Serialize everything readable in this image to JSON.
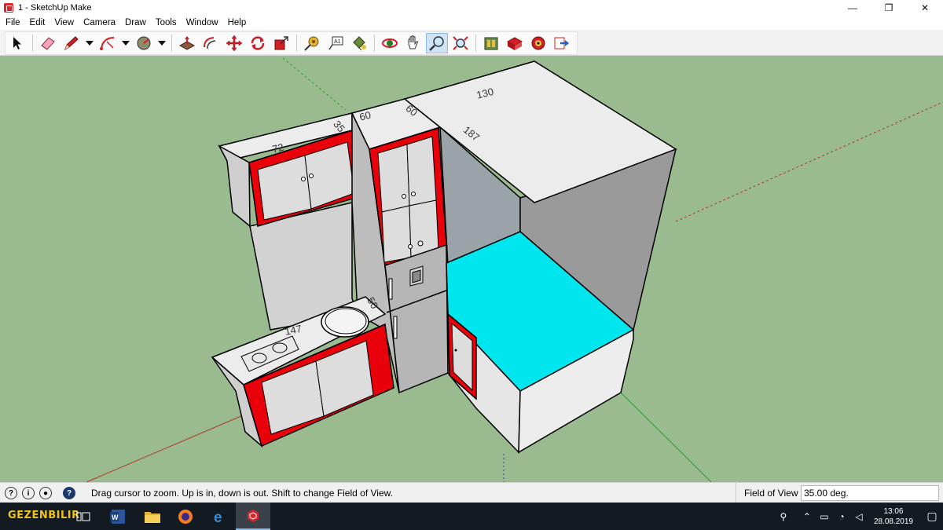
{
  "window": {
    "title": "1 - SketchUp Make",
    "controls": [
      "—",
      "❐",
      "✕"
    ]
  },
  "menu": [
    "File",
    "Edit",
    "View",
    "Camera",
    "Draw",
    "Tools",
    "Window",
    "Help"
  ],
  "toolbar": {
    "tools": [
      {
        "name": "select",
        "icon": "cursor-arrow"
      },
      {
        "name": "eraser",
        "icon": "eraser"
      },
      {
        "name": "pencil",
        "icon": "pencil"
      },
      {
        "name": "arc",
        "icon": "arc"
      },
      {
        "name": "shapes",
        "icon": "circle-shape"
      },
      {
        "name": "push-pull",
        "icon": "push-pull"
      },
      {
        "name": "offset",
        "icon": "offset"
      },
      {
        "name": "move",
        "icon": "move-arrows"
      },
      {
        "name": "rotate",
        "icon": "rotate"
      },
      {
        "name": "scale",
        "icon": "scale"
      },
      {
        "name": "tape-measure",
        "icon": "tape-measure"
      },
      {
        "name": "text",
        "icon": "text-label"
      },
      {
        "name": "paint-bucket",
        "icon": "paint-bucket"
      },
      {
        "name": "orbit",
        "icon": "orbit"
      },
      {
        "name": "pan",
        "icon": "pan-hand"
      },
      {
        "name": "zoom",
        "icon": "zoom",
        "active": true
      },
      {
        "name": "zoom-extents",
        "icon": "zoom-extents"
      },
      {
        "name": "3d-warehouse",
        "icon": "warehouse"
      },
      {
        "name": "extension-warehouse",
        "icon": "extension"
      },
      {
        "name": "layout",
        "icon": "layout"
      },
      {
        "name": "send-to",
        "icon": "send-to"
      }
    ]
  },
  "model": {
    "dimensions": [
      "130",
      "187",
      "60",
      "60",
      "35",
      "72",
      "50",
      "147"
    ],
    "colors": {
      "ground": "#99bb8f",
      "cabinet_red": "#e8000b",
      "surface_white": "#ededed",
      "panel_gray": "#c8c8c8",
      "wall_gray": "#9a9a9a",
      "bed_cyan": "#00e6ee"
    }
  },
  "status": {
    "message": "Drag cursor to zoom.  Up is in, down is out. Shift to change Field of View.",
    "fov_label": "Field of View",
    "fov_value": "35.00 deg."
  },
  "taskbar": {
    "logo": "GEZENBILIR",
    "apps": [
      "task-view",
      "word",
      "file-explorer",
      "firefox",
      "edge",
      "sketchup"
    ],
    "time": "13:06",
    "date": "28.08.2019"
  }
}
